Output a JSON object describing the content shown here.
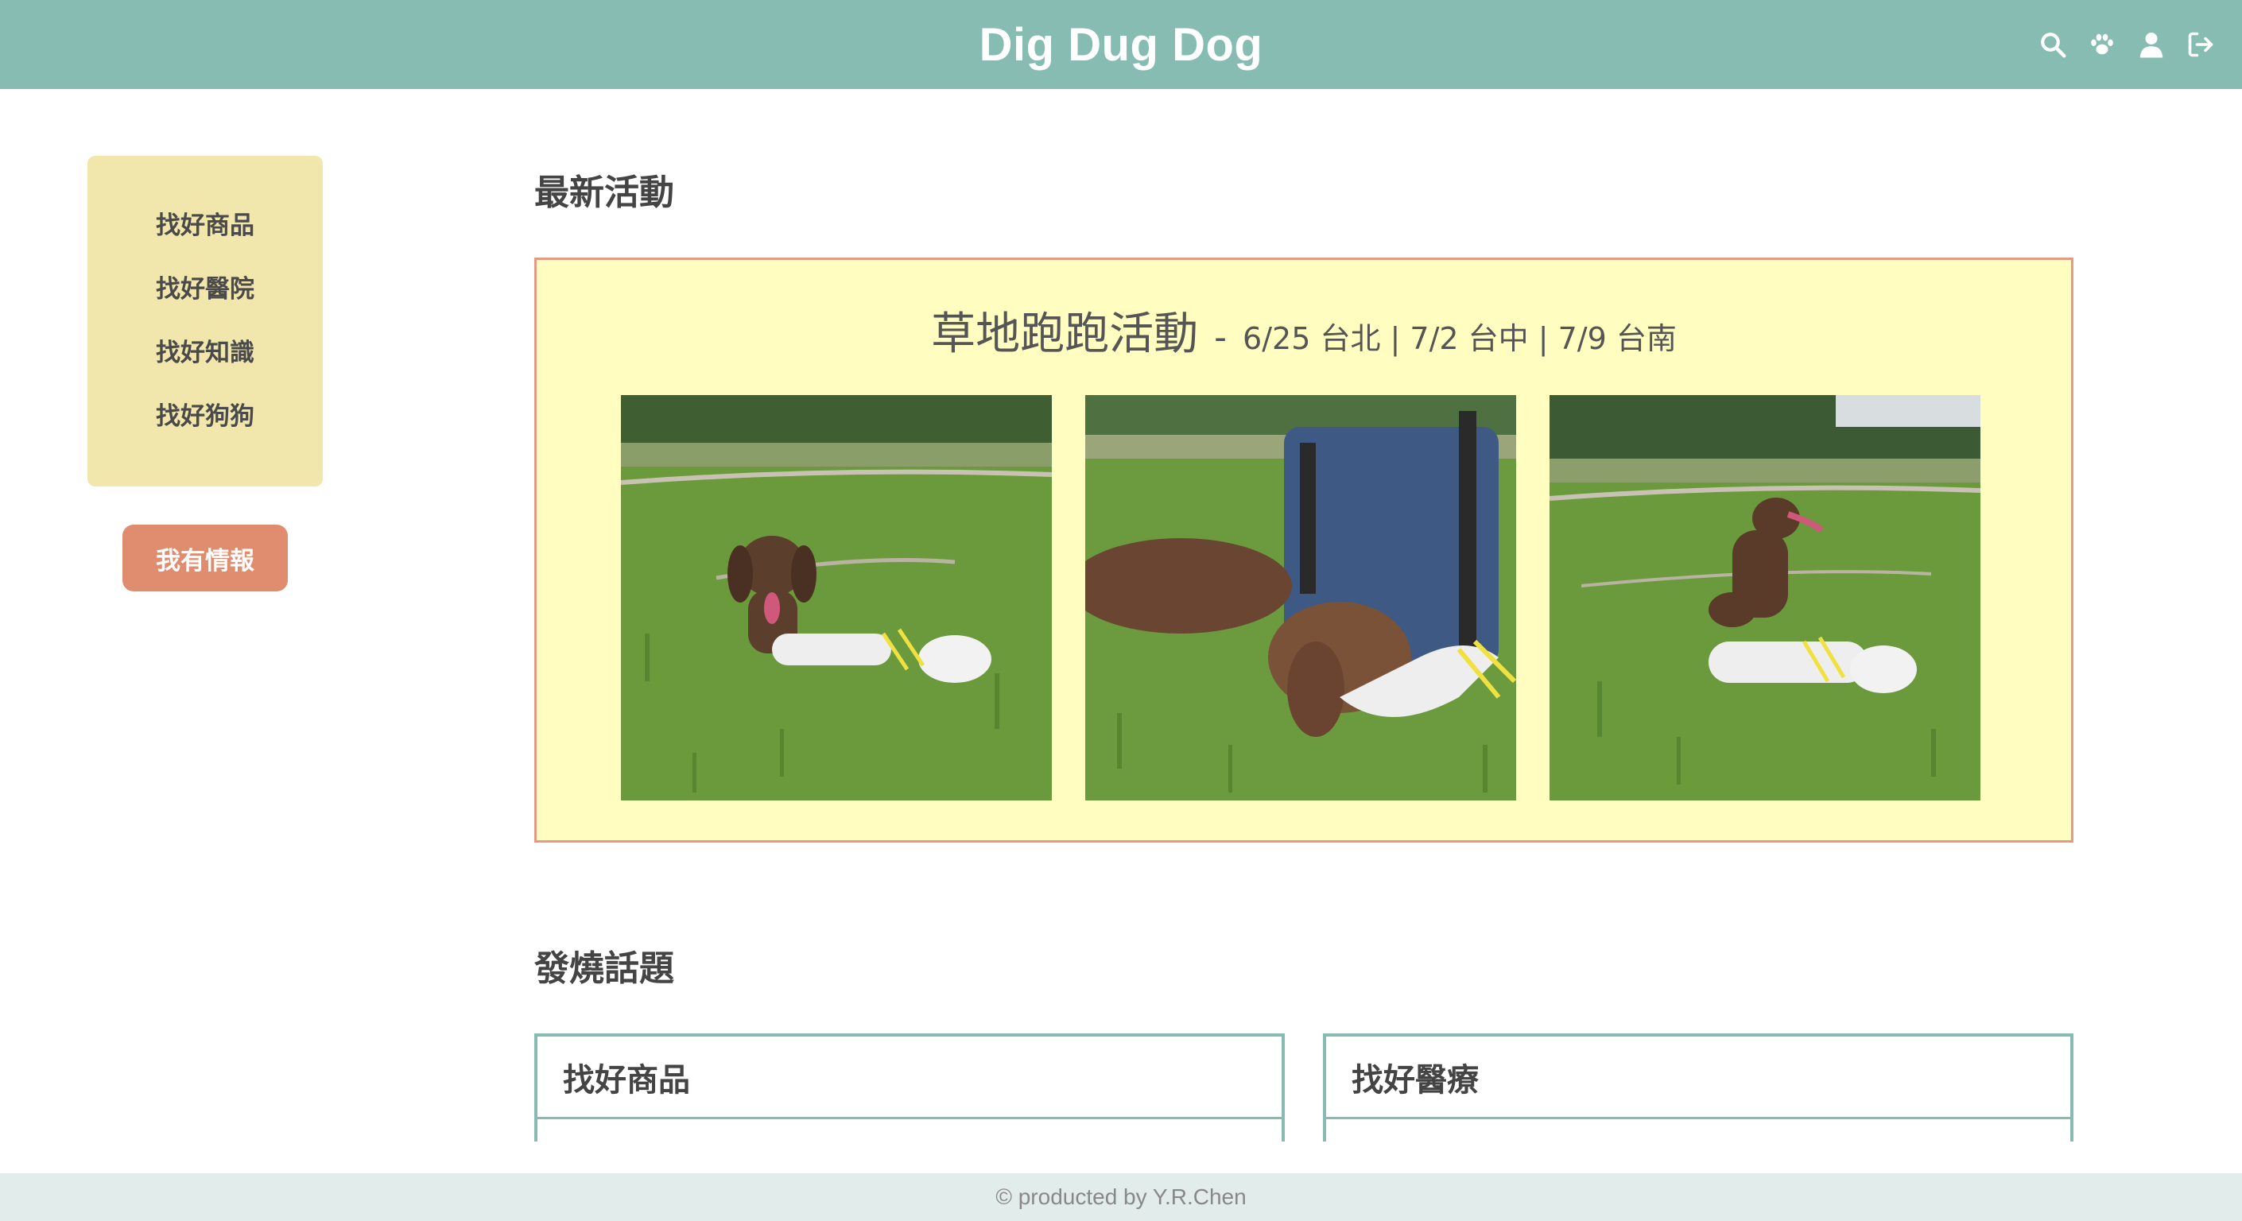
{
  "header": {
    "brand": "Dig Dug Dog",
    "icons": [
      "search-icon",
      "paw-icon",
      "user-icon",
      "logout-icon"
    ],
    "bg_color": "#86bcb1"
  },
  "sidebar": {
    "items": [
      {
        "label": "找好商品"
      },
      {
        "label": "找好醫院"
      },
      {
        "label": "找好知識"
      },
      {
        "label": "找好狗狗"
      }
    ],
    "report_button": "我有情報"
  },
  "main": {
    "latest_title": "最新活動",
    "event": {
      "name": "草地跑跑活動",
      "dash": "-",
      "dates": "6/25 台北 | 7/2 台中 | 7/9 台南",
      "photos": [
        "dog-on-grass-photo",
        "dog-drinking-photo",
        "dog-sitting-photo"
      ]
    },
    "hot_title": "發燒話題",
    "cards": [
      {
        "title": "找好商品"
      },
      {
        "title": "找好醫療"
      }
    ]
  },
  "footer": {
    "text": "© producted by Y.R.Chen"
  }
}
